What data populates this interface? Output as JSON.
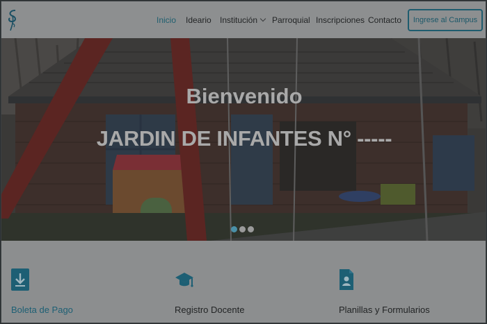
{
  "navbar": {
    "logo_icon": "script-s-logo-icon",
    "items": [
      {
        "label": "Inicio",
        "active": true
      },
      {
        "label": "Ideario"
      },
      {
        "label": "Institución",
        "dropdown": true
      },
      {
        "label": "Parroquial"
      },
      {
        "label": "Inscripciones"
      },
      {
        "label": "Contacto"
      }
    ],
    "campus_button": "Ingrese al Campus"
  },
  "hero": {
    "title": "Bienvenido",
    "subtitle": "JARDIN DE INFANTES N° -----",
    "slides": 3,
    "active_slide": 1
  },
  "features": [
    {
      "label": "Boleta de Pago",
      "icon": "download-box-icon"
    },
    {
      "label": "Registro Docente",
      "icon": "graduation-cap-icon"
    },
    {
      "label": "Planillas y Formularios",
      "icon": "document-user-icon"
    }
  ],
  "colors": {
    "accent": "#1e5c6e",
    "navbar_bg": "#8d8f90",
    "features_bg": "#8c8e8f"
  }
}
